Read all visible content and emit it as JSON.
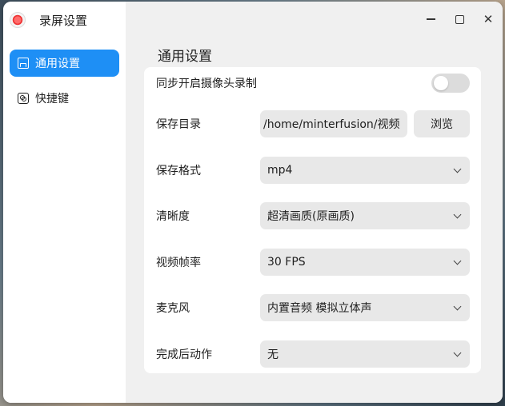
{
  "app": {
    "title": "录屏设置",
    "icon": "record-app-icon"
  },
  "window_controls": {
    "minimize": "minimize-icon",
    "maximize": "maximize-icon",
    "close_glyph": "✕"
  },
  "sidebar": {
    "items": [
      {
        "label": "通用设置",
        "icon": "save-icon",
        "active": true
      },
      {
        "label": "快捷键",
        "icon": "keyboard-icon",
        "active": false
      }
    ]
  },
  "main": {
    "section_title": "通用设置",
    "settings": {
      "camera": {
        "label": "同步开启摄像头录制",
        "enabled": false
      },
      "save_dir": {
        "label": "保存目录",
        "value": "/home/minterfusion/视频",
        "browse_label": "浏览"
      },
      "format": {
        "label": "保存格式",
        "value": "mp4"
      },
      "quality": {
        "label": "清晰度",
        "value": "超清画质(原画质)"
      },
      "fps": {
        "label": "视频帧率",
        "value": "30 FPS"
      },
      "mic": {
        "label": "麦克风",
        "value": "内置音频 模拟立体声"
      },
      "after_action": {
        "label": "完成后动作",
        "value": "无"
      }
    }
  },
  "colors": {
    "accent": "#1e8ff5",
    "panel_bg": "#f0f0f0",
    "control_bg": "#e8e8e8"
  }
}
